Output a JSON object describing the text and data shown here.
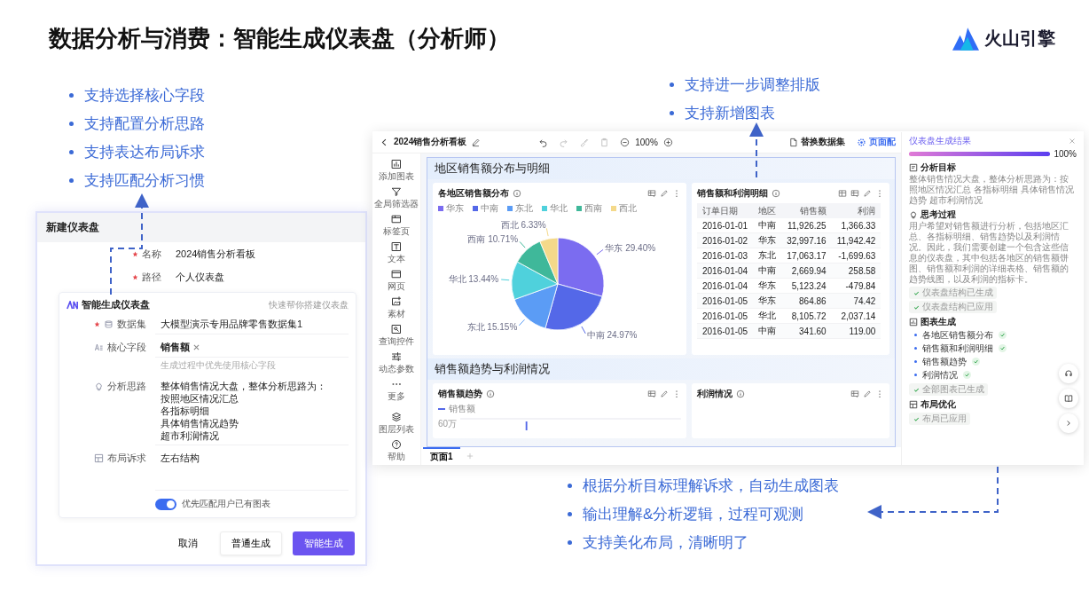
{
  "slide": {
    "title": "数据分析与消费：智能生成仪表盘（分析师）",
    "logo_text": "火山引擎"
  },
  "left_notes": [
    "支持选择核心字段",
    "支持配置分析思路",
    "支持表达布局诉求",
    "支持匹配分析习惯"
  ],
  "top_notes": [
    "支持进一步调整排版",
    "支持新增图表"
  ],
  "bottom_notes": [
    "根据分析目标理解诉求，自动生成图表",
    "输出理解&分析逻辑，过程可观测",
    "支持美化布局，清晰明了"
  ],
  "new_dashboard_dialog": {
    "title": "新建仪表盘",
    "fields": [
      {
        "label": "名称",
        "value": "2024销售分析看板",
        "required": true
      },
      {
        "label": "路径",
        "value": "个人仪表盘",
        "required": true
      }
    ],
    "smart_panel": {
      "title": "智能生成仪表盘",
      "subtitle": "快速帮你搭建仪表盘",
      "fields": [
        {
          "kind": "select",
          "label": "数据集",
          "required": true,
          "value": "大模型演示专用品牌零售数据集1"
        },
        {
          "kind": "tags",
          "label": "核心字段",
          "required": false,
          "tags": [
            "销售额"
          ],
          "hint": "生成过程中优先使用核心字段"
        },
        {
          "kind": "textarea",
          "label": "分析思路",
          "required": false,
          "lines": [
            "整体销售情况大盘，整体分析思路为：",
            "按照地区情况汇总",
            "各指标明细",
            "具体销售情况趋势",
            "超市利润情况"
          ]
        },
        {
          "kind": "textarea",
          "label": "布局诉求",
          "required": false,
          "lines": [
            "左右结构"
          ]
        }
      ],
      "toggle": {
        "label": "优先匹配用户已有图表",
        "on": true
      }
    },
    "buttons": [
      {
        "label": "取消",
        "kind": "text"
      },
      {
        "label": "普通生成",
        "kind": "default"
      },
      {
        "label": "智能生成",
        "kind": "primary"
      }
    ]
  },
  "dashboard": {
    "title": "2024销售分析看板",
    "zoom": "100%",
    "actions": [
      "替换数据集",
      "页面配"
    ],
    "sidebar": {
      "top": [
        "添加图表",
        "全局筛选器",
        "标签页",
        "文本",
        "网页",
        "素材",
        "查询控件",
        "动态参数",
        "更多"
      ],
      "bottom": [
        "图层列表",
        "帮助"
      ]
    },
    "sections": [
      {
        "title": "地区销售额分布与明细",
        "cards": [
          {
            "kind": "pie",
            "title": "各地区销售额分布",
            "chart_data": {
              "type": "pie",
              "categories": [
                "华东",
                "中南",
                "东北",
                "华北",
                "西南",
                "西北"
              ],
              "colors": [
                "#7b6cf0",
                "#5468e8",
                "#5b9cf5",
                "#4fd1dc",
                "#3fb89a",
                "#f4d98a"
              ],
              "values": [
                29.4,
                24.97,
                15.15,
                13.44,
                10.71,
                6.33
              ],
              "value_labels": [
                "华东 29.40%",
                "中南 24.97%",
                "东北 15.15%",
                "华北 13.44%",
                "西南 10.71%",
                "西北 6.33%"
              ]
            }
          },
          {
            "kind": "table",
            "title": "销售额和利润明细",
            "columns": [
              "订单日期",
              "地区",
              "销售额",
              "利润"
            ],
            "rows": [
              [
                "2016-01-01",
                "中南",
                "11,926.25",
                "1,366.33"
              ],
              [
                "2016-01-02",
                "华东",
                "32,997.16",
                "11,942.42"
              ],
              [
                "2016-01-03",
                "东北",
                "17,063.17",
                "-1,699.63"
              ],
              [
                "2016-01-04",
                "中南",
                "2,669.94",
                "258.58"
              ],
              [
                "2016-01-04",
                "华东",
                "5,123.24",
                "-479.84"
              ],
              [
                "2016-01-05",
                "华东",
                "864.86",
                "74.42"
              ],
              [
                "2016-01-05",
                "华北",
                "8,105.72",
                "2,037.14"
              ],
              [
                "2016-01-05",
                "中南",
                "341.60",
                "119.00"
              ]
            ]
          }
        ]
      },
      {
        "title": "销售额趋势与利润情况",
        "cards": [
          {
            "kind": "line",
            "title": "销售额趋势",
            "legend": "销售额",
            "ytick": "60万"
          },
          {
            "kind": "empty",
            "title": "利润情况"
          }
        ]
      }
    ],
    "pages": [
      {
        "label": "页面1",
        "selected": true
      }
    ],
    "result_panel": {
      "title": "仪表盘生成结果",
      "level": 1,
      "percent": "100%",
      "steps": [
        {
          "title": "分析目标",
          "text": "整体销售情况大盘，整体分析思路为：按照地区情况汇总 各指标明细 具体销售情况趋势 超市利润情况"
        },
        {
          "title": "思考过程",
          "text": "用户希望对销售额进行分析，包括地区汇总、各指标明细、销售趋势以及利润情况。因此，我们需要创建一个包含这些信息的仪表盘，其中包括各地区的销售额饼图、销售额和利润的详细表格、销售额的趋势线图，以及利润的指标卡。",
          "tags": [
            "仪表盘结构已生成",
            "仪表盘结构已应用"
          ]
        },
        {
          "title": "图表生成",
          "items": [
            {
              "label": "各地区销售额分布",
              "done": true
            },
            {
              "label": "销售额和利润明细",
              "done": true
            },
            {
              "label": "销售额趋势",
              "done": true
            },
            {
              "label": "利润情况",
              "done": true
            }
          ],
          "tags": [
            "全部图表已生成"
          ]
        },
        {
          "title": "布局优化",
          "tags": [
            "布局已应用"
          ]
        }
      ]
    }
  }
}
